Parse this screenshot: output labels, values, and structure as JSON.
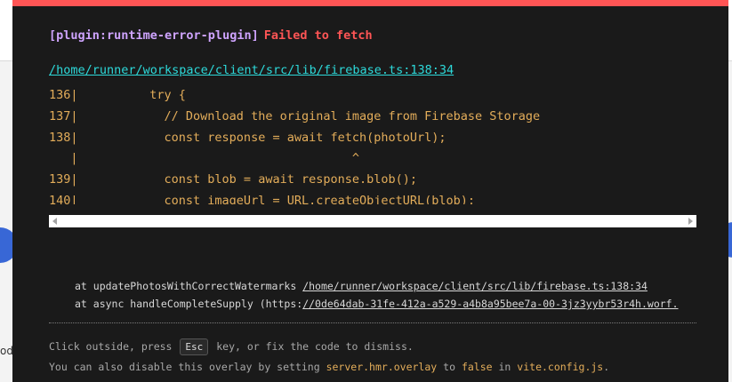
{
  "background": {
    "fragment_text": "oda"
  },
  "overlay": {
    "plugin": "[plugin:runtime-error-plugin]",
    "message": "Failed to fetch",
    "file": "/home/runner/workspace/client/src/lib/firebase.ts:138:34",
    "frame": [
      {
        "ln": "136|",
        "code": "          try {"
      },
      {
        "ln": "137|",
        "code": "            // Download the original image from Firebase Storage"
      },
      {
        "ln": "138|",
        "code": "            const response = await fetch(photoUrl);"
      },
      {
        "ln": "   |",
        "code": "                                      ^"
      },
      {
        "ln": "139|",
        "code": "            const blob = await response.blob();"
      },
      {
        "ln": "140|",
        "code": "            const imageUrl = URL.createObjectURL(blob);"
      }
    ],
    "stack": [
      {
        "prefix": "at updatePhotosWithCorrectWatermarks ",
        "link": "/home/runner/workspace/client/src/lib/firebase.ts:138:34",
        "suffix": ""
      },
      {
        "prefix": "at async handleCompleteSupply (https:",
        "link": "//0de64dab-31fe-412a-a529-a4b8a95bee7a-00-3jz3yybr53r4h.worf.",
        "suffix": ""
      }
    ],
    "tip": {
      "line1_a": "Click outside, press",
      "key": "Esc",
      "line1_b": "key, or fix the code to dismiss.",
      "line2_a": "You can also disable this overlay by setting",
      "setting": "server.hmr.overlay",
      "line2_b": "to",
      "value": "false",
      "line2_c": "in",
      "file": "vite.config.js",
      "line2_d": "."
    },
    "accent_color": "#ff5555"
  }
}
